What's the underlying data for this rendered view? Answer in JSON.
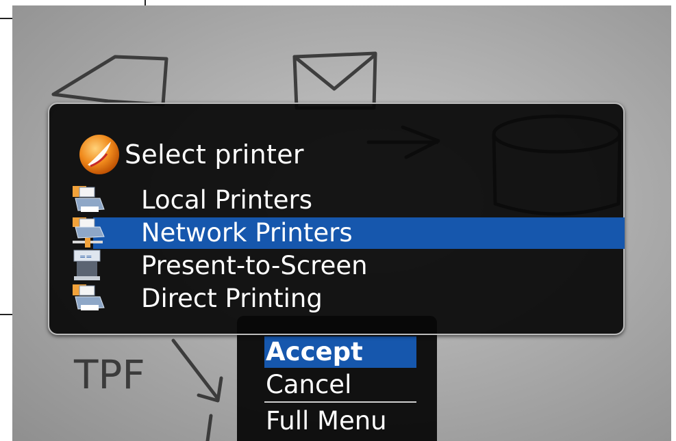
{
  "dialog": {
    "title": "Select printer",
    "printers": [
      {
        "label": "Local Printers",
        "icon": "printer-icon",
        "selected": false
      },
      {
        "label": "Network Printers",
        "icon": "network-printer-icon",
        "selected": true
      },
      {
        "label": "Present-to-Screen",
        "icon": "projector-icon",
        "selected": false
      },
      {
        "label": "Direct Printing",
        "icon": "printer-icon",
        "selected": false
      }
    ]
  },
  "menu": {
    "accept": "Accept",
    "cancel": "Cancel",
    "full_menu": "Full Menu"
  },
  "background": {
    "sketch_text": "TPF"
  },
  "colors": {
    "highlight": "#1657ad",
    "dialog_bg": "#080808"
  }
}
